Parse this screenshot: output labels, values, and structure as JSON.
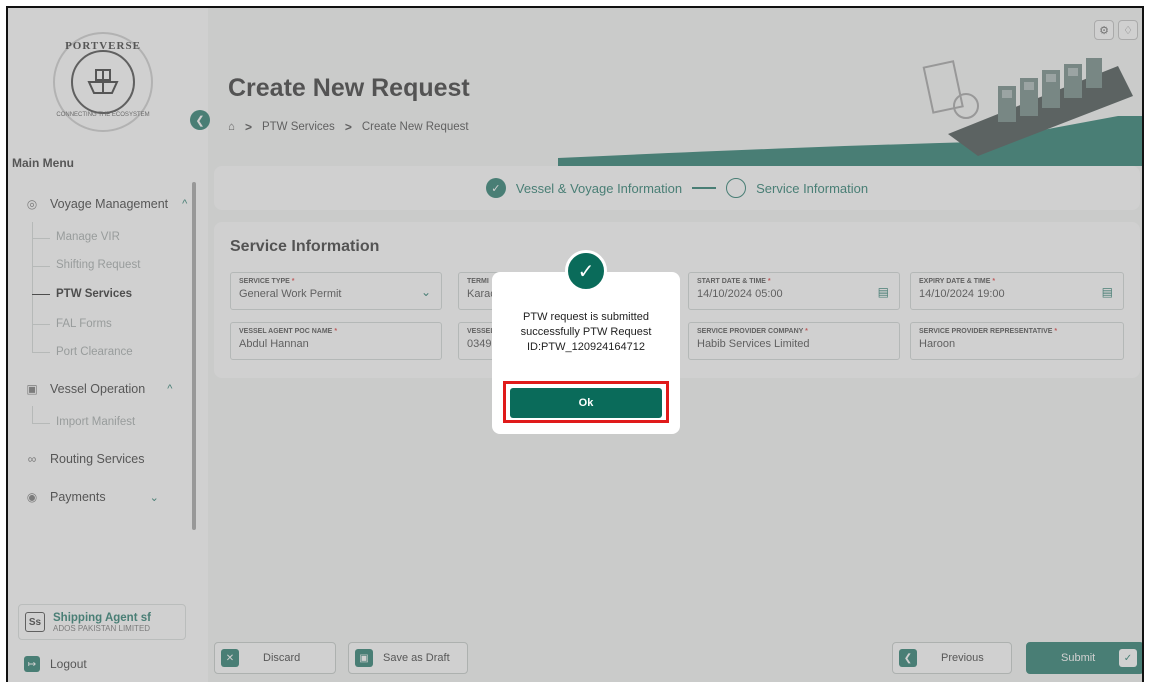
{
  "sidebar": {
    "logo": {
      "word": "PORTVERSE",
      "tagline": "CONNECTING THE ECOSYSTEM"
    },
    "main_menu": "Main Menu",
    "groups": [
      {
        "label": "Voyage Management",
        "icon": "compass-icon",
        "chevron": "^"
      },
      {
        "label": "Vessel Operation",
        "icon": "ship-icon",
        "chevron": "^"
      },
      {
        "label": "Routing Services",
        "icon": "route-icon"
      },
      {
        "label": "Payments",
        "icon": "coin-icon",
        "chevron": "v"
      }
    ],
    "items": [
      "Manage VIR",
      "Shifting Request",
      "PTW Services",
      "FAL Forms",
      "Port Clearance",
      "Import Manifest"
    ],
    "user": {
      "initials": "Ss",
      "name": "Shipping Agent sf",
      "company": "ADOS PAKISTAN LIMITED"
    },
    "logout": "Logout"
  },
  "header": {
    "title": "Create New Request",
    "breadcrumb": [
      "PTW Services",
      "Create New Request"
    ]
  },
  "stepper": {
    "step1": "Vessel & Voyage Information",
    "step2": "Service Information"
  },
  "card": {
    "title": "Service Information",
    "fields": [
      {
        "label": "SERVICE TYPE",
        "value": "General Work Permit"
      },
      {
        "label": "TERMI",
        "value": "Karac"
      },
      {
        "label": "START DATE & TIME",
        "value": "14/10/2024 05:00"
      },
      {
        "label": "EXPIRY DATE & TIME",
        "value": "14/10/2024 19:00"
      },
      {
        "label": "VESSEL AGENT POC NAME",
        "value": "Abdul Hannan"
      },
      {
        "label": "VESSEL",
        "value": "03491"
      },
      {
        "label": "SERVICE PROVIDER COMPANY",
        "value": "Habib Services Limited"
      },
      {
        "label": "SERVICE PROVIDER REPRESENTATIVE",
        "value": "Haroon"
      }
    ]
  },
  "footer": {
    "discard": "Discard",
    "save_draft": "Save as Draft",
    "previous": "Previous",
    "submit": "Submit"
  },
  "modal": {
    "line1": "PTW request is submitted",
    "line2": "successfully PTW Request",
    "line3": "ID:PTW_120924164712",
    "ok": "Ok"
  },
  "colors": {
    "accent": "#0a6b5a",
    "highlight": "#e01a1a"
  }
}
